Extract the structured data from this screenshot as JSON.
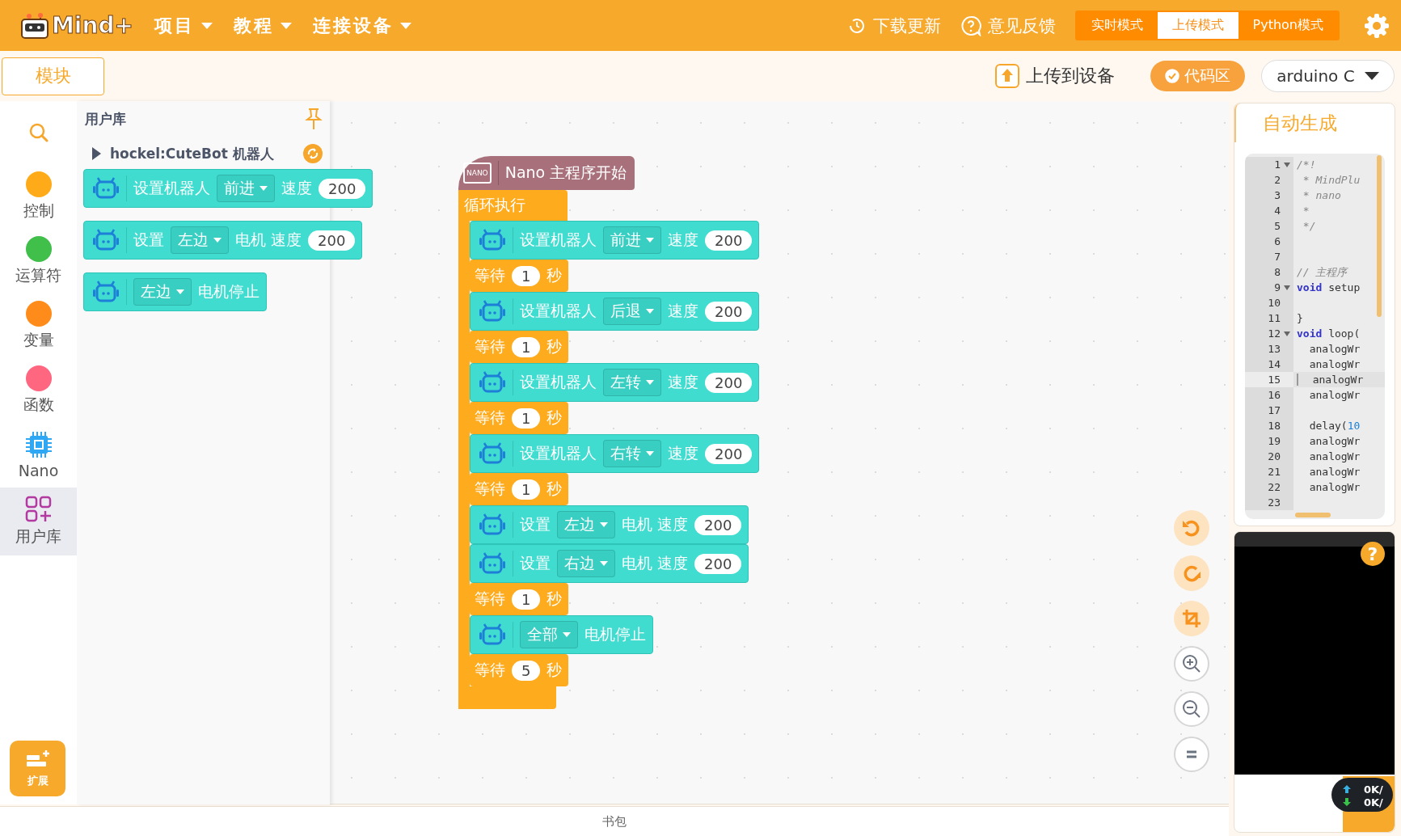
{
  "menubar": {
    "logo": "Mind+",
    "menus": [
      "项目",
      "教程",
      "连接设备"
    ],
    "actions": [
      {
        "kind": "download",
        "label": "下载更新"
      },
      {
        "kind": "feedback",
        "label": "意见反馈"
      }
    ],
    "modes": [
      {
        "label": "实时模式",
        "selected": false
      },
      {
        "label": "上传模式",
        "selected": true
      },
      {
        "label": "Python模式",
        "selected": false
      }
    ]
  },
  "toolbar": {
    "tab": "模块",
    "upload": "上传到设备",
    "code_area": {
      "label": "代码区",
      "checked": true
    },
    "language": "arduino C"
  },
  "categories": [
    {
      "kind": "search",
      "selected": false
    },
    {
      "kind": "dot",
      "label": "控制",
      "color": "#ffab19",
      "selected": false
    },
    {
      "kind": "dot",
      "label": "运算符",
      "color": "#40bf4a",
      "selected": false
    },
    {
      "kind": "dot",
      "label": "变量",
      "color": "#ff8c1a",
      "selected": false
    },
    {
      "kind": "dot",
      "label": "函数",
      "color": "#ff6680",
      "selected": false
    },
    {
      "kind": "chip",
      "label": "Nano",
      "selected": false
    },
    {
      "kind": "library",
      "label": "用户库",
      "selected": true
    }
  ],
  "extension": "扩展",
  "palette": {
    "title": "用户库",
    "library": {
      "name": "hockel:CuteBot 机器人",
      "expanded": false
    },
    "blocks": [
      {
        "kind": "robot",
        "parts": [
          {
            "kind": "text",
            "text": "设置机器人"
          },
          {
            "kind": "dropdown",
            "text": "前进"
          },
          {
            "kind": "text",
            "text": "速度"
          },
          {
            "kind": "number",
            "text": "200"
          }
        ]
      },
      {
        "kind": "robot",
        "parts": [
          {
            "kind": "text",
            "text": "设置"
          },
          {
            "kind": "dropdown",
            "text": "左边"
          },
          {
            "kind": "text",
            "text": "电机 速度"
          },
          {
            "kind": "number",
            "text": "200"
          }
        ]
      },
      {
        "kind": "robot",
        "parts": [
          {
            "kind": "dropdown",
            "text": "左边"
          },
          {
            "kind": "text",
            "text": "电机停止"
          }
        ]
      }
    ]
  },
  "script": {
    "hat": {
      "badge": "NANO",
      "label": "Nano 主程序开始"
    },
    "loop": "循环执行",
    "statements": [
      {
        "kind": "robot",
        "parts": [
          {
            "kind": "text",
            "text": "设置机器人"
          },
          {
            "kind": "dropdown",
            "text": "前进"
          },
          {
            "kind": "text",
            "text": "速度"
          },
          {
            "kind": "number",
            "text": "200"
          }
        ]
      },
      {
        "kind": "wait",
        "parts": [
          {
            "kind": "text",
            "text": "等待"
          },
          {
            "kind": "number",
            "text": "1"
          },
          {
            "kind": "text",
            "text": "秒"
          }
        ]
      },
      {
        "kind": "robot",
        "parts": [
          {
            "kind": "text",
            "text": "设置机器人"
          },
          {
            "kind": "dropdown",
            "text": "后退"
          },
          {
            "kind": "text",
            "text": "速度"
          },
          {
            "kind": "number",
            "text": "200"
          }
        ]
      },
      {
        "kind": "wait",
        "parts": [
          {
            "kind": "text",
            "text": "等待"
          },
          {
            "kind": "number",
            "text": "1"
          },
          {
            "kind": "text",
            "text": "秒"
          }
        ]
      },
      {
        "kind": "robot",
        "parts": [
          {
            "kind": "text",
            "text": "设置机器人"
          },
          {
            "kind": "dropdown",
            "text": "左转"
          },
          {
            "kind": "text",
            "text": "速度"
          },
          {
            "kind": "number",
            "text": "200"
          }
        ]
      },
      {
        "kind": "wait",
        "parts": [
          {
            "kind": "text",
            "text": "等待"
          },
          {
            "kind": "number",
            "text": "1"
          },
          {
            "kind": "text",
            "text": "秒"
          }
        ]
      },
      {
        "kind": "robot",
        "parts": [
          {
            "kind": "text",
            "text": "设置机器人"
          },
          {
            "kind": "dropdown",
            "text": "右转"
          },
          {
            "kind": "text",
            "text": "速度"
          },
          {
            "kind": "number",
            "text": "200"
          }
        ]
      },
      {
        "kind": "wait",
        "parts": [
          {
            "kind": "text",
            "text": "等待"
          },
          {
            "kind": "number",
            "text": "1"
          },
          {
            "kind": "text",
            "text": "秒"
          }
        ]
      },
      {
        "kind": "robot",
        "parts": [
          {
            "kind": "text",
            "text": "设置"
          },
          {
            "kind": "dropdown",
            "text": "左边"
          },
          {
            "kind": "text",
            "text": "电机 速度"
          },
          {
            "kind": "number",
            "text": "200"
          }
        ]
      },
      {
        "kind": "robot",
        "parts": [
          {
            "kind": "text",
            "text": "设置"
          },
          {
            "kind": "dropdown",
            "text": "右边"
          },
          {
            "kind": "text",
            "text": "电机 速度"
          },
          {
            "kind": "number",
            "text": "200"
          }
        ]
      },
      {
        "kind": "wait",
        "parts": [
          {
            "kind": "text",
            "text": "等待"
          },
          {
            "kind": "number",
            "text": "1"
          },
          {
            "kind": "text",
            "text": "秒"
          }
        ]
      },
      {
        "kind": "robot",
        "parts": [
          {
            "kind": "dropdown",
            "text": "全部"
          },
          {
            "kind": "text",
            "text": "电机停止"
          }
        ]
      },
      {
        "kind": "wait",
        "parts": [
          {
            "kind": "text",
            "text": "等待"
          },
          {
            "kind": "number",
            "text": "5"
          },
          {
            "kind": "text",
            "text": "秒"
          }
        ]
      }
    ]
  },
  "canvas_controls": [
    {
      "kind": "undo"
    },
    {
      "kind": "redo"
    },
    {
      "kind": "crop"
    },
    {
      "kind": "zoom_in"
    },
    {
      "kind": "zoom_out"
    },
    {
      "kind": "reset"
    }
  ],
  "code_panel": {
    "tab": "自动生成",
    "lines": [
      {
        "n": "1",
        "fold": true,
        "selected": false,
        "tokens": [
          {
            "kind": "comment",
            "text": "/*!"
          }
        ]
      },
      {
        "n": "2",
        "fold": false,
        "selected": false,
        "tokens": [
          {
            "kind": "comment",
            "text": " * MindPlu"
          }
        ]
      },
      {
        "n": "3",
        "fold": false,
        "selected": false,
        "tokens": [
          {
            "kind": "comment",
            "text": " * nano"
          }
        ]
      },
      {
        "n": "4",
        "fold": false,
        "selected": false,
        "tokens": [
          {
            "kind": "comment",
            "text": " *"
          }
        ]
      },
      {
        "n": "5",
        "fold": false,
        "selected": false,
        "tokens": [
          {
            "kind": "comment",
            "text": " */"
          }
        ]
      },
      {
        "n": "6",
        "fold": false,
        "selected": false
      },
      {
        "n": "7",
        "fold": false,
        "selected": false
      },
      {
        "n": "8",
        "fold": false,
        "selected": false,
        "tokens": [
          {
            "kind": "comment",
            "text": "// 主程序"
          }
        ]
      },
      {
        "n": "9",
        "fold": true,
        "selected": false,
        "tokens": [
          {
            "kind": "keyword",
            "text": "void"
          },
          {
            "kind": "plain",
            "text": " setup"
          }
        ]
      },
      {
        "n": "10",
        "fold": false,
        "selected": false
      },
      {
        "n": "11",
        "fold": false,
        "selected": false,
        "tokens": [
          {
            "kind": "plain",
            "text": "}"
          }
        ]
      },
      {
        "n": "12",
        "fold": true,
        "selected": false,
        "tokens": [
          {
            "kind": "keyword",
            "text": "void"
          },
          {
            "kind": "plain",
            "text": " loop("
          }
        ]
      },
      {
        "n": "13",
        "fold": false,
        "selected": false,
        "tokens": [
          {
            "kind": "plain",
            "text": "  analogWr"
          }
        ]
      },
      {
        "n": "14",
        "fold": false,
        "selected": false,
        "tokens": [
          {
            "kind": "plain",
            "text": "  analogWr"
          }
        ]
      },
      {
        "n": "15",
        "fold": false,
        "selected": true,
        "tokens": [
          {
            "kind": "plain",
            "text": "  analogWr"
          }
        ]
      },
      {
        "n": "16",
        "fold": false,
        "selected": false,
        "tokens": [
          {
            "kind": "plain",
            "text": "  analogWr"
          }
        ]
      },
      {
        "n": "17",
        "fold": false,
        "selected": false
      },
      {
        "n": "18",
        "fold": false,
        "selected": false,
        "tokens": [
          {
            "kind": "plain",
            "text": "  delay("
          },
          {
            "kind": "number",
            "text": "10"
          }
        ]
      },
      {
        "n": "19",
        "fold": false,
        "selected": false,
        "tokens": [
          {
            "kind": "plain",
            "text": "  analogWr"
          }
        ]
      },
      {
        "n": "20",
        "fold": false,
        "selected": false,
        "tokens": [
          {
            "kind": "plain",
            "text": "  analogWr"
          }
        ]
      },
      {
        "n": "21",
        "fold": false,
        "selected": false,
        "tokens": [
          {
            "kind": "plain",
            "text": "  analogWr"
          }
        ]
      },
      {
        "n": "22",
        "fold": false,
        "selected": false,
        "tokens": [
          {
            "kind": "plain",
            "text": "  analogWr"
          }
        ]
      },
      {
        "n": "23",
        "fold": false,
        "selected": false
      }
    ]
  },
  "console": {
    "help": "?"
  },
  "net_speed": [
    {
      "kind": "up",
      "text": "0K/"
    },
    {
      "kind": "down",
      "text": "0K/"
    }
  ],
  "backpack": "书包"
}
